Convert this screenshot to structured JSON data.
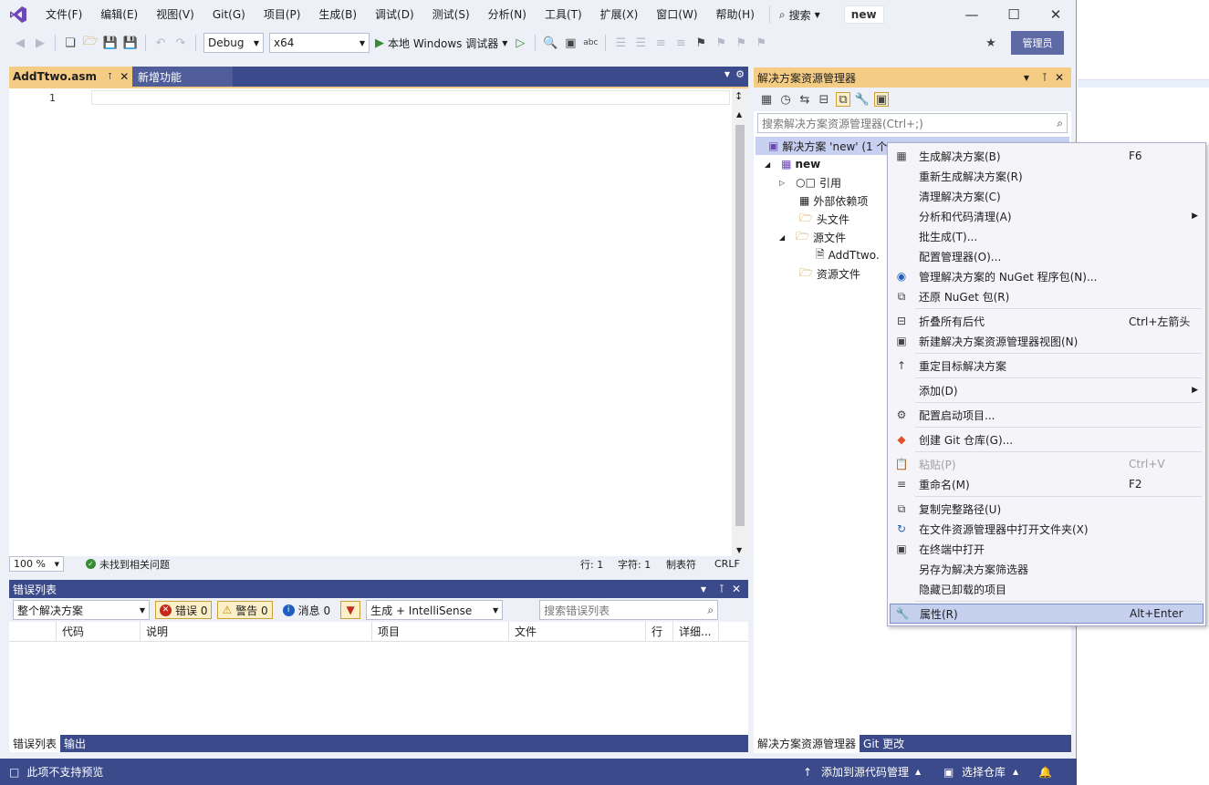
{
  "menubar": {
    "items": [
      "文件(F)",
      "编辑(E)",
      "视图(V)",
      "Git(G)",
      "项目(P)",
      "生成(B)",
      "调试(D)",
      "测试(S)",
      "分析(N)",
      "工具(T)",
      "扩展(X)",
      "窗口(W)",
      "帮助(H)"
    ],
    "search_label": "搜索",
    "project_name": "new"
  },
  "toolbar": {
    "config": "Debug",
    "platform": "x64",
    "run_label": "本地 Windows 调试器",
    "admin_label": "管理员"
  },
  "editor": {
    "tabs": [
      "AddTtwo.asm",
      "新增功能"
    ],
    "line_number": "1",
    "zoom": "100 %",
    "issues": "未找到相关问题",
    "row": "行: 1",
    "col": "字符: 1",
    "indent": "制表符",
    "eol": "CRLF"
  },
  "error_list": {
    "title": "错误列表",
    "scope": "整个解决方案",
    "errors": "错误 0",
    "warnings": "警告 0",
    "messages": "消息 0",
    "build_filter": "生成 + IntelliSense",
    "search_placeholder": "搜索错误列表",
    "columns": [
      "代码",
      "说明",
      "项目",
      "文件",
      "行",
      "详细..."
    ],
    "bottom_tabs": [
      "错误列表",
      "输出"
    ]
  },
  "solution_explorer": {
    "title": "解决方案资源管理器",
    "search_placeholder": "搜索解决方案资源管理器(Ctrl+;)",
    "root": "解决方案 'new' (1 个",
    "project": "new",
    "nodes": [
      "引用",
      "外部依赖项",
      "头文件",
      "源文件",
      "AddTtwo.",
      "资源文件"
    ],
    "bottom_tabs": [
      "解决方案资源管理器",
      "Git 更改"
    ]
  },
  "context_menu": {
    "items": [
      {
        "label": "生成解决方案(B)",
        "shortcut": "F6",
        "icon": "build-icon"
      },
      {
        "label": "重新生成解决方案(R)",
        "shortcut": "",
        "icon": ""
      },
      {
        "label": "清理解决方案(C)",
        "shortcut": "",
        "icon": ""
      },
      {
        "label": "分析和代码清理(A)",
        "shortcut": "",
        "icon": "",
        "submenu": true
      },
      {
        "label": "批生成(T)...",
        "shortcut": "",
        "icon": ""
      },
      {
        "label": "配置管理器(O)...",
        "shortcut": "",
        "icon": ""
      },
      {
        "label": "管理解决方案的 NuGet 程序包(N)...",
        "shortcut": "",
        "icon": "nuget-icon"
      },
      {
        "label": "还原 NuGet 包(R)",
        "shortcut": "",
        "icon": "restore-icon"
      },
      {
        "label": "折叠所有后代",
        "shortcut": "Ctrl+左箭头",
        "icon": "collapse-icon"
      },
      {
        "label": "新建解决方案资源管理器视图(N)",
        "shortcut": "",
        "icon": "new-view-icon"
      },
      {
        "label": "重定目标解决方案",
        "shortcut": "",
        "icon": "arrow-up-icon"
      },
      {
        "label": "添加(D)",
        "shortcut": "",
        "icon": "",
        "submenu": true
      },
      {
        "label": "配置启动项目...",
        "shortcut": "",
        "icon": "gear-icon"
      },
      {
        "label": "创建 Git 仓库(G)...",
        "shortcut": "",
        "icon": "git-icon"
      },
      {
        "label": "粘贴(P)",
        "shortcut": "Ctrl+V",
        "icon": "paste-icon",
        "disabled": true
      },
      {
        "label": "重命名(M)",
        "shortcut": "F2",
        "icon": "rename-icon"
      },
      {
        "label": "复制完整路径(U)",
        "shortcut": "",
        "icon": "copy-icon"
      },
      {
        "label": "在文件资源管理器中打开文件夹(X)",
        "shortcut": "",
        "icon": "open-folder-icon"
      },
      {
        "label": "在终端中打开",
        "shortcut": "",
        "icon": "terminal-icon"
      },
      {
        "label": "另存为解决方案筛选器",
        "shortcut": "",
        "icon": ""
      },
      {
        "label": "隐藏已卸载的项目",
        "shortcut": "",
        "icon": ""
      },
      {
        "label": "属性(R)",
        "shortcut": "Alt+Enter",
        "icon": "wrench-icon",
        "highlighted": true
      }
    ]
  },
  "statusbar": {
    "left": "此项不支持预览",
    "source_control": "添加到源代码管理",
    "repo": "选择仓库"
  }
}
